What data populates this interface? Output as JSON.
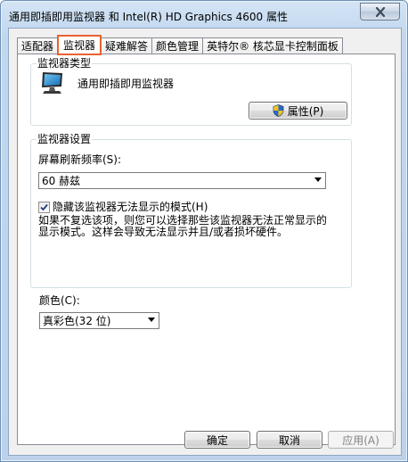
{
  "window": {
    "title": "通用即插即用监视器 和 Intel(R) HD Graphics 4600 属性"
  },
  "tabs": [
    {
      "label": "适配器"
    },
    {
      "label": "监视器",
      "active": true
    },
    {
      "label": "疑难解答"
    },
    {
      "label": "颜色管理"
    },
    {
      "label": "英特尔® 核芯显卡控制面板"
    }
  ],
  "monitor_type": {
    "group_title": "监视器类型",
    "name": "通用即插即用监视器",
    "properties_button": "属性(P)"
  },
  "monitor_settings": {
    "group_title": "监视器设置",
    "refresh_label": "屏幕刷新频率(S):",
    "refresh_value": "60 赫兹",
    "hide_modes_label": "隐藏该监视器无法显示的模式(H)",
    "hide_modes_checked": true,
    "description_line1": "如果不复选该项，则您可以选择那些该监视器无法正常显示的",
    "description_line2": "显示模式。这样会导致无法显示并且/或者损坏硬件。"
  },
  "colors": {
    "label": "颜色(C):",
    "value": "真彩色(32 位)"
  },
  "footer": {
    "ok": "确定",
    "cancel": "取消",
    "apply": "应用(A)"
  }
}
